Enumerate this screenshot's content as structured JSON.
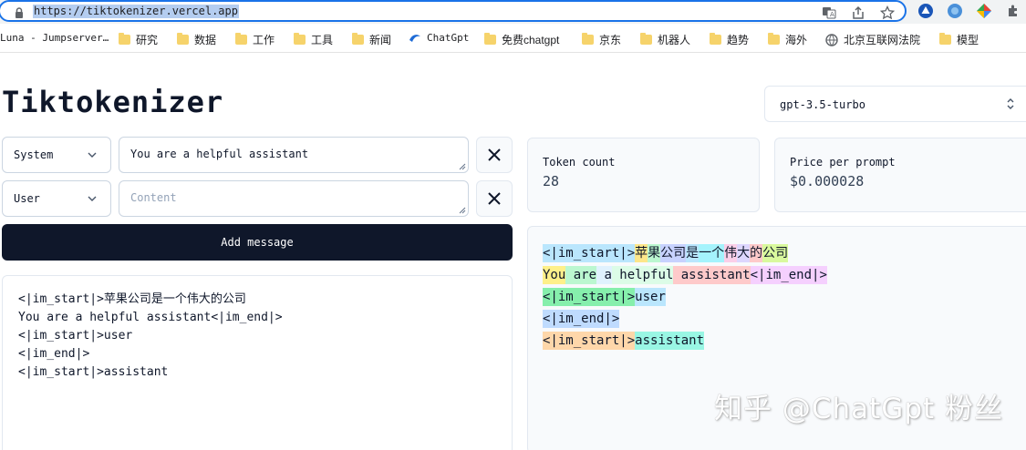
{
  "browser": {
    "url": "https://tiktokenizer.vercel.app",
    "bookmarks": [
      "Luna - Jumpserver…",
      "研究",
      "数据",
      "工作",
      "工具",
      "新闻",
      "ChatGpt",
      "免费chatgpt",
      "京东",
      "机器人",
      "趋势",
      "海外",
      "北京互联网法院",
      "模型"
    ]
  },
  "app": {
    "title": "Tiktokenizer",
    "model": "gpt-3.5-turbo",
    "messages": [
      {
        "role": "System",
        "content": "You are a helpful assistant",
        "placeholder": "Content"
      },
      {
        "role": "User",
        "content": "",
        "placeholder": "Content"
      }
    ],
    "add_message_label": "Add message",
    "output_lines": [
      "<|im_start|>苹果公司是一个伟大的公司",
      "You are a helpful assistant<|im_end|>",
      "<|im_start|>user",
      "<|im_end|>",
      "<|im_start|>assistant"
    ],
    "token_count_label": "Token count",
    "token_count": "28",
    "price_label": "Price per prompt",
    "price": "$0.000028",
    "token_lines": [
      [
        {
          "t": "<|im_start|>",
          "c": "#bae6fd"
        },
        {
          "t": "苹",
          "c": "#fde68a"
        },
        {
          "t": "果",
          "c": "#bbf7d0"
        },
        {
          "t": "公司",
          "c": "#c7d2fe"
        },
        {
          "t": "是",
          "c": "#bae6fd"
        },
        {
          "t": "一个",
          "c": "#a5f3fc"
        },
        {
          "t": "伟",
          "c": "#fbcfe8"
        },
        {
          "t": "大",
          "c": "#ddd6fe"
        },
        {
          "t": "的",
          "c": "#fecaca"
        },
        {
          "t": "公司",
          "c": "#d9f99d"
        }
      ],
      [
        {
          "t": "You",
          "c": "#fef08a"
        },
        {
          "t": " are",
          "c": "#bbf7d0"
        },
        {
          "t": " a",
          "c": "#e0f2fe"
        },
        {
          "t": " helpful",
          "c": "#dcfce7"
        },
        {
          "t": " assistant",
          "c": "#fecaca"
        },
        {
          "t": "<|im_end|>",
          "c": "#f5d0fe"
        }
      ],
      [
        {
          "t": "<|im_start|>",
          "c": "#86efac"
        },
        {
          "t": "user",
          "c": "#bae6fd"
        }
      ],
      [
        {
          "t": "<|im_end|>",
          "c": "#bfdbfe"
        }
      ],
      [
        {
          "t": "<|im_start|>",
          "c": "#fed7aa"
        },
        {
          "t": "assistant",
          "c": "#99f6e4"
        }
      ]
    ],
    "watermark": "知乎 @ChatGpt 粉丝"
  }
}
